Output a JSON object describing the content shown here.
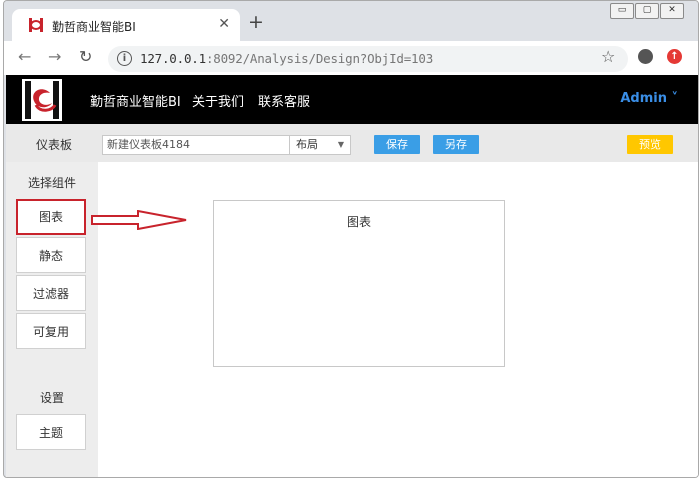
{
  "browser": {
    "tab_title": "勤哲商业智能BI",
    "tab_close": "✕",
    "new_tab": "+",
    "url_host": "127.0.0.1",
    "url_rest": ":8092/Analysis/Design?ObjId=103",
    "nav": {
      "back": "←",
      "forward": "→",
      "reload": "↻"
    },
    "icons": {
      "info": "i",
      "bookmark": "☆",
      "update": "↑"
    },
    "window_controls": {
      "minimize": "▭",
      "maximize": "▢",
      "close": "✕"
    }
  },
  "header": {
    "nav_items": [
      "勤哲商业智能BI",
      "关于我们",
      "联系客服"
    ],
    "user": "Admin ˅"
  },
  "toolbar": {
    "label": "仪表板",
    "name_value": "新建仪表板4184",
    "layout_value": "布局",
    "layout_caret": "▼",
    "save_label": "保存",
    "save_as_label": "另存",
    "preview_label": "预览"
  },
  "sidebar": {
    "components_title": "选择组件",
    "components": [
      "图表",
      "静态",
      "过滤器",
      "可复用"
    ],
    "settings_title": "设置",
    "settings_items": [
      "主题"
    ]
  },
  "canvas": {
    "chart_title": "图表"
  },
  "colors": {
    "accent_blue": "#3a9ee6",
    "preview_yellow": "#ffc700",
    "highlight_red": "#c8232c",
    "header_bg": "#000000"
  }
}
